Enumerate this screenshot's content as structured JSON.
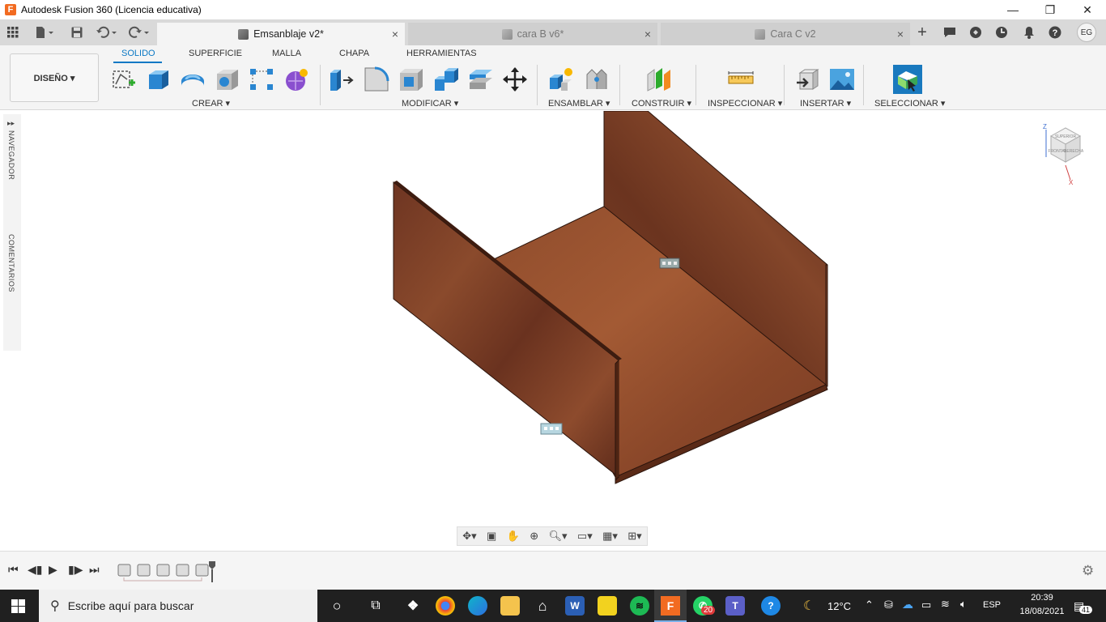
{
  "window": {
    "title": "Autodesk Fusion 360 (Licencia educativa)",
    "logo_letter": "F",
    "minimize": "—",
    "restore": "❐",
    "close": "✕"
  },
  "tabs": [
    {
      "label": "Emsanblaje v2*",
      "active": true
    },
    {
      "label": "cara B v6*",
      "active": false
    },
    {
      "label": "Cara C v2",
      "active": false
    }
  ],
  "tab_close": "×",
  "tab_add": "+",
  "user_initials": "EG",
  "workspace": {
    "label": "DISEÑO ▾"
  },
  "workspace_tabs": [
    {
      "label": "SOLIDO",
      "active": true
    },
    {
      "label": "SUPERFICIE"
    },
    {
      "label": "MALLA"
    },
    {
      "label": "CHAPA"
    },
    {
      "label": "HERRAMIENTAS"
    }
  ],
  "groups": {
    "crear": "CREAR ▾",
    "modificar": "MODIFICAR ▾",
    "ensamblar": "ENSAMBLAR ▾",
    "construir": "CONSTRUIR ▾",
    "inspeccionar": "INSPECCIONAR ▾",
    "insertar": "INSERTAR ▾",
    "seleccionar": "SELECCIONAR ▾"
  },
  "side_panel": {
    "navegador": "NAVEGADOR",
    "comentarios": "COMENTARIOS"
  },
  "viewcube": {
    "top": "SUPERIOR",
    "front": "FRONTAL",
    "right": "DERECHA",
    "z": "Z",
    "x": "X"
  },
  "taskbar": {
    "search_placeholder": "Escribe aquí para buscar",
    "temperature": "12°C",
    "language": "ESP",
    "time": "20:39",
    "date": "18/08/2021",
    "whatsapp_badge": "20",
    "notifications_badge": "41"
  },
  "colors": {
    "accent": "#0a78c4",
    "wood": "#7a3d25",
    "taskbar": "#202020",
    "fusion_orange": "#f26b21"
  }
}
